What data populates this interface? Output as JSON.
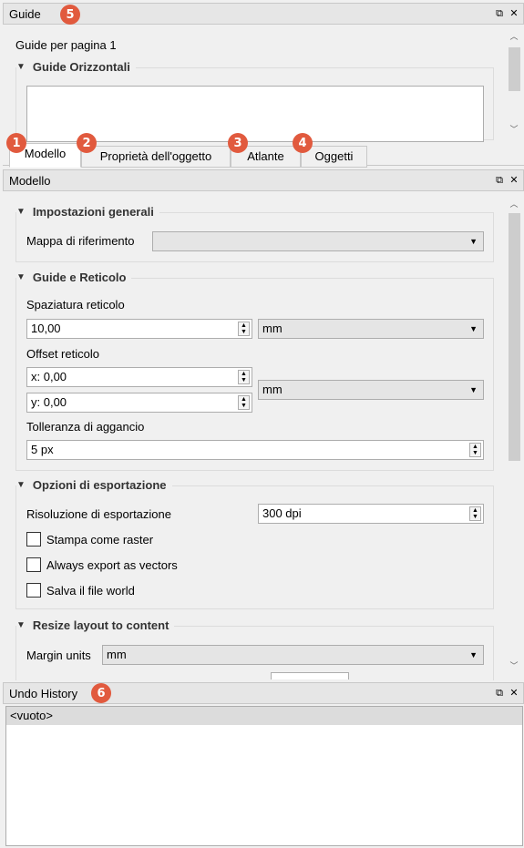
{
  "guide_panel": {
    "title": "Guide",
    "badge": "5",
    "pages_label": "Guide per pagina 1",
    "horizontal_group": "Guide Orizzontali"
  },
  "tabs": [
    {
      "label": "Modello",
      "badge": "1",
      "active": true
    },
    {
      "label": "Proprietà dell'oggetto",
      "badge": "2"
    },
    {
      "label": "Atlante",
      "badge": "3"
    },
    {
      "label": "Oggetti",
      "badge": "4"
    }
  ],
  "modello_panel": {
    "title": "Modello",
    "general": {
      "group": "Impostazioni generali",
      "ref_map_label": "Mappa di riferimento",
      "ref_map_value": ""
    },
    "grid": {
      "group": "Guide e Reticolo",
      "spacing_label": "Spaziatura reticolo",
      "spacing_value": "10,00",
      "spacing_unit": "mm",
      "offset_label": "Offset reticolo",
      "offset_x": "x: 0,00",
      "offset_y": "y: 0,00",
      "offset_unit": "mm",
      "snap_label": "Tolleranza di aggancio",
      "snap_value": "5 px"
    },
    "export": {
      "group": "Opzioni di esportazione",
      "resolution_label": "Risoluzione di esportazione",
      "resolution_value": "300 dpi",
      "print_raster": "Stampa come raster",
      "export_vectors": "Always export as vectors",
      "save_world": "Salva il file world"
    },
    "resize": {
      "group": "Resize layout to content",
      "margin_units_label": "Margin units",
      "margin_units_value": "mm"
    }
  },
  "undo_panel": {
    "title": "Undo History",
    "badge": "6",
    "items": [
      "<vuoto>"
    ]
  },
  "icons": {
    "float": "⧉",
    "close": "✕",
    "collapse": "▼",
    "combo_arrow": "▼",
    "up": "▲",
    "down": "▼",
    "scroll_up": "︿",
    "scroll_down": "﹀"
  },
  "colors": {
    "badge": "#e15a3e"
  }
}
